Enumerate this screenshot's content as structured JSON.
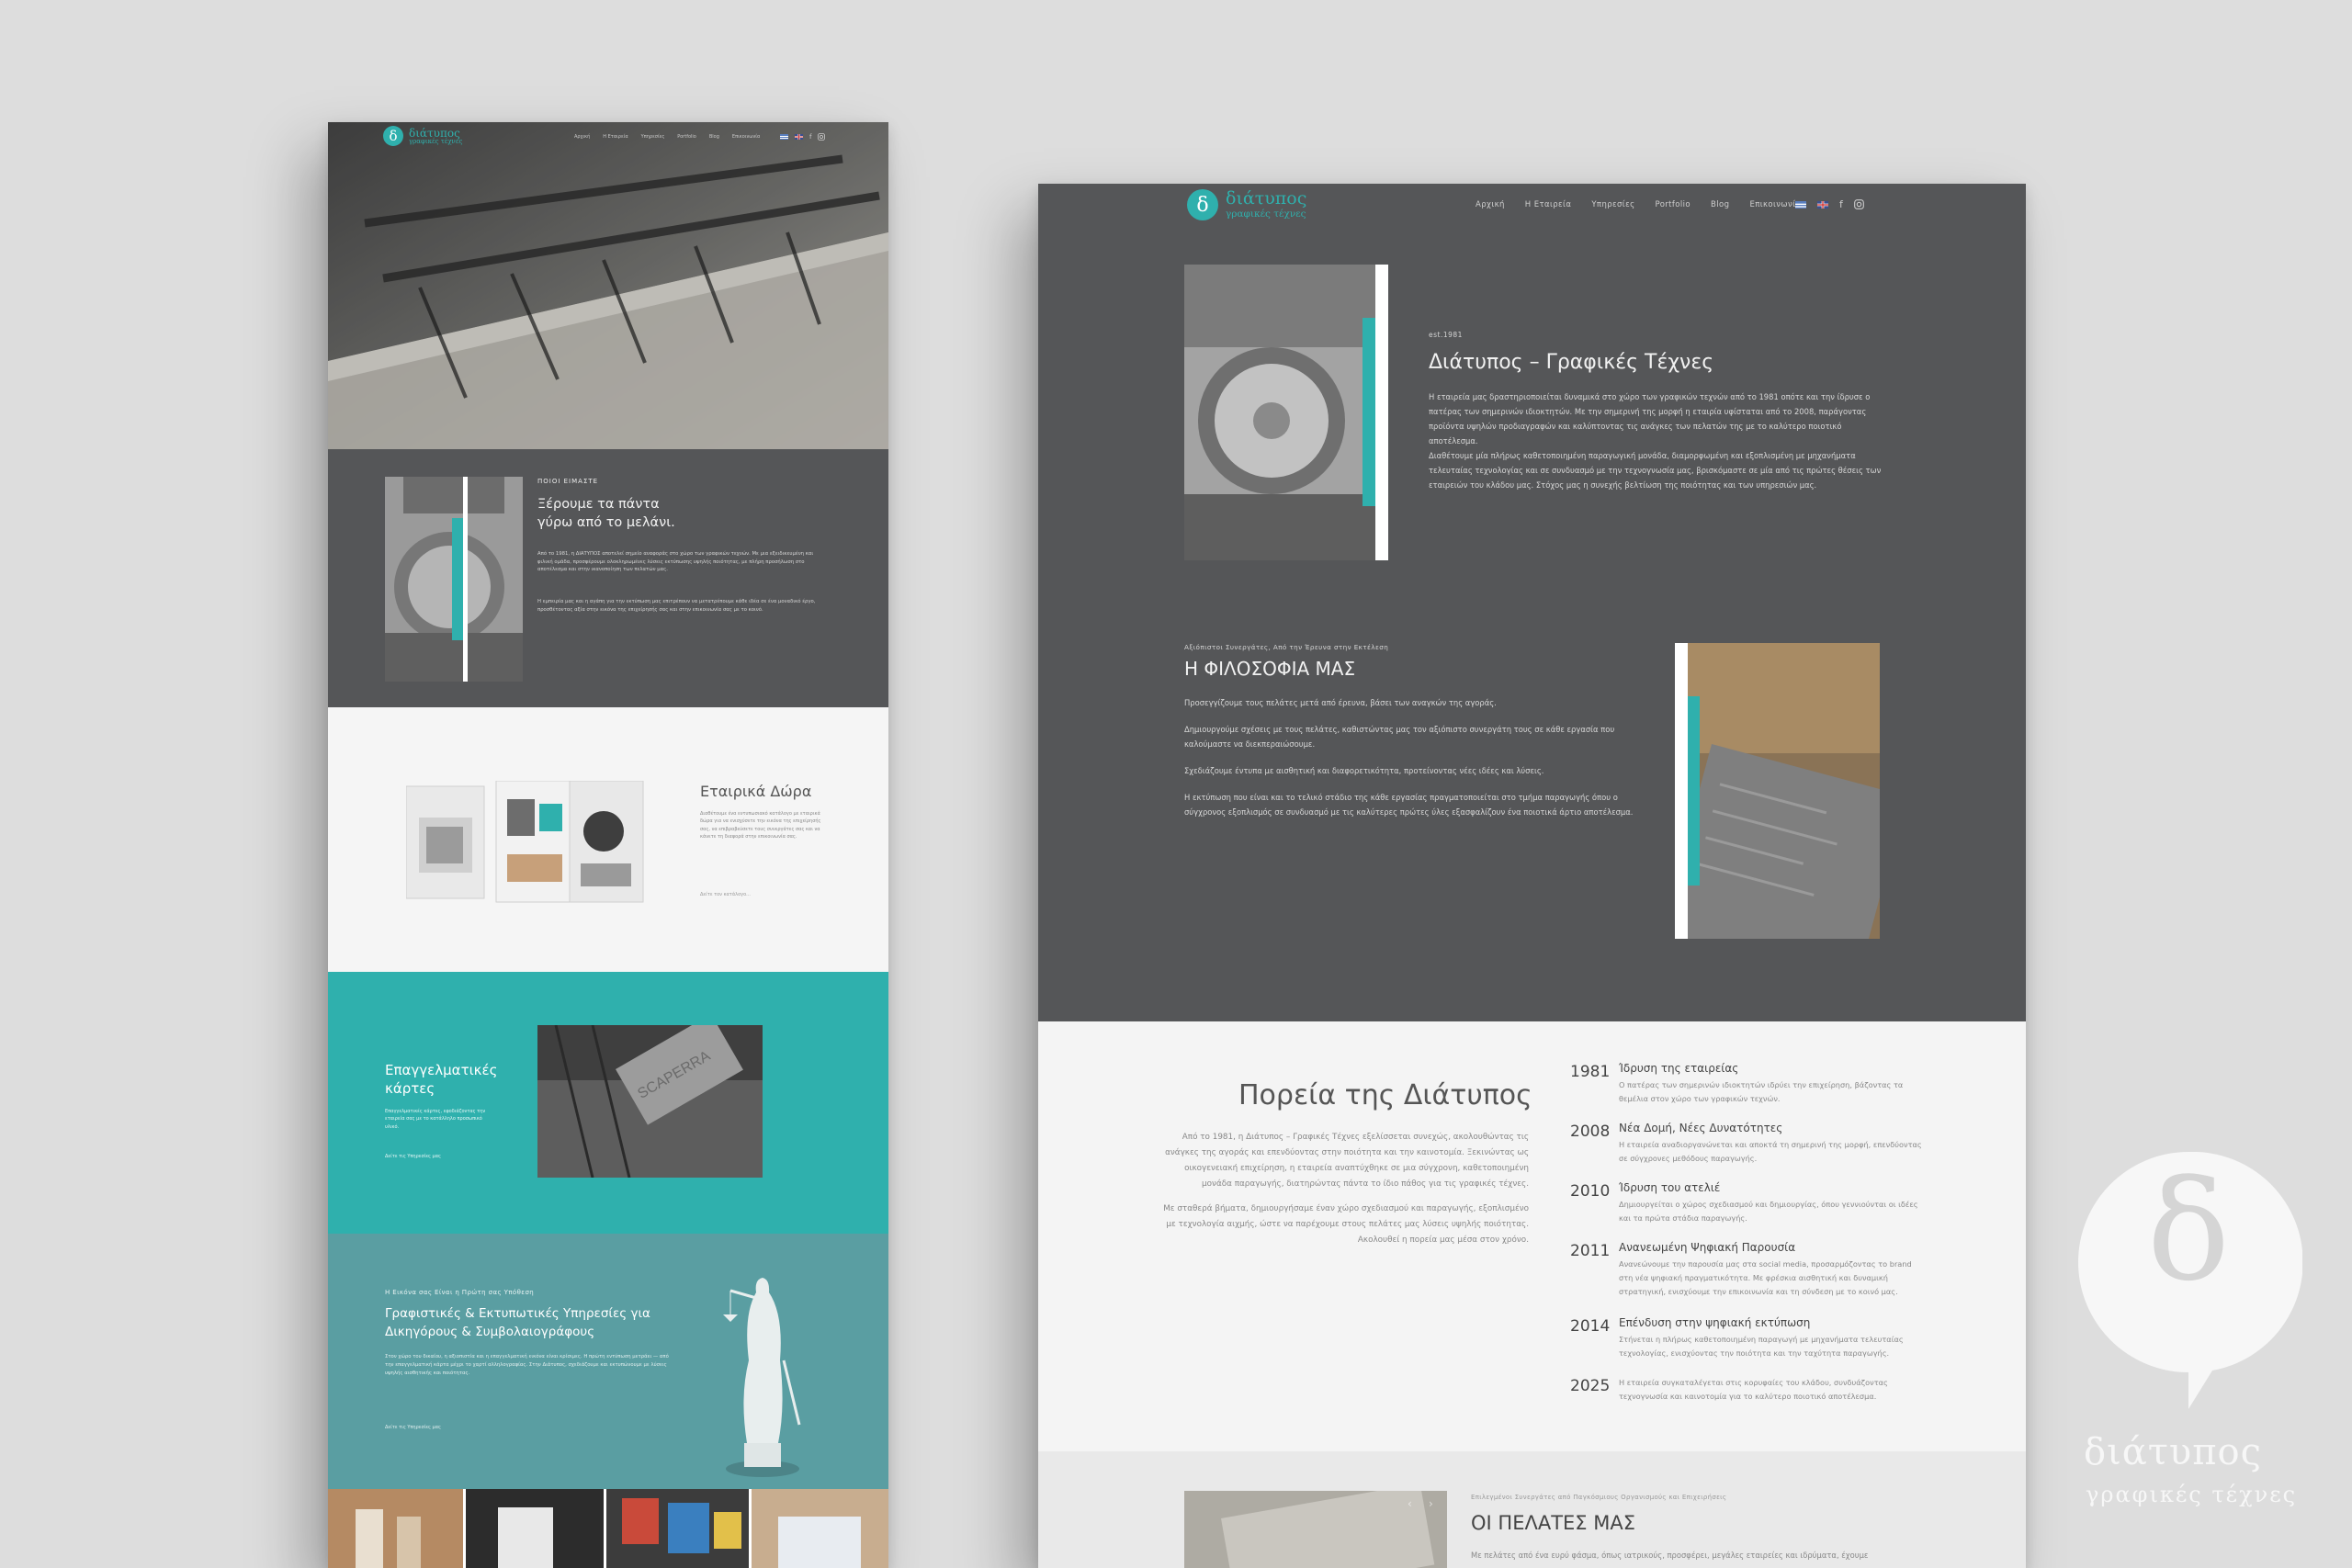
{
  "brand": {
    "logo_mark": "δ",
    "name": "διάτυπος",
    "tagline": "γραφικές τέχνες"
  },
  "nav": {
    "items": [
      "Αρχική",
      "Η Εταιρεία",
      "Υπηρεσίες",
      "Portfolio",
      "Blog",
      "Επικοινωνία"
    ]
  },
  "icons": [
    "facebook-icon",
    "instagram-icon",
    "flag-gr-icon",
    "flag-en-icon"
  ],
  "colors": {
    "accent": "#2fb0ad",
    "dark": "#555658",
    "legal": "#5a9ea2",
    "light": "#f4f4f4"
  },
  "left": {
    "about": {
      "eyebrow": "ΠΟΙΟΙ ΕΙΜΑΣΤΕ",
      "title_line1": "Ξέρουμε τα πάντα",
      "title_line2": "γύρω από το μελάνι.",
      "p1": "Από το 1981, η ΔΙΑΤΥΠΟΣ αποτελεί σημείο αναφοράς στο χώρο των γραφικών τεχνών. Με μια εξειδικευμένη και φιλική ομάδα, προσφέρουμε ολοκληρωμένες λύσεις εκτύπωσης υψηλής ποιότητας, με πλήρη προσήλωση στο αποτέλεσμα και στην ικανοποίηση των πελατών μας.",
      "p2": "Η εμπειρία μας και η αγάπη για την εκτύπωση μας επιτρέπουν να μετατρέπουμε κάθε ιδέα σε ένα μοναδικό έργο, προσθέτοντας αξία στην εικόνα της επιχείρησής σας και στην επικοινωνία σας με το κοινό."
    },
    "gifts": {
      "title": "Εταιρικά Δώρα",
      "body": "Διαθέτουμε ένα εντυπωσιακό κατάλογο με εταιρικά δώρα για να ενισχύσετε την εικόνα της επιχείρησής σας, να επιβραβεύσετε τους συνεργάτες σας και να κάνετε τη διαφορά στην επικοινωνία σας.",
      "link": "Δείτε τον κατάλογο..."
    },
    "cards": {
      "title_line1": "Επαγγελματικές",
      "title_line2": "κάρτες",
      "body": "Επαγγελματικές κάρτες, εφοδιάζοντας την εταιρεία σας με το κατάλληλο προσωπικό υλικό.",
      "link": "Δείτε τις Υπηρεσίες μας"
    },
    "legal": {
      "eyebrow": "Η Εικόνα σας Είναι η Πρώτη σας Υπόθεση",
      "title_line1": "Γραφιστικές & Εκτυπωτικές Υπηρεσίες για",
      "title_line2": "Δικηγόρους & Συμβολαιογράφους",
      "body": "Στον χώρο του δικαίου, η αξιοπιστία και η επαγγελματική εικόνα είναι κρίσιμες. Η πρώτη εντύπωση μετράει — από την επαγγελματική κάρτα μέχρι το χαρτί αλληλογραφίας. Στην Διάτυπος, σχεδιάζουμε και εκτυπώνουμε με λύσεις υψηλής αισθητικής και ποιότητας.",
      "link": "Δείτε τις Υπηρεσίες μας"
    }
  },
  "right": {
    "intro": {
      "eyebrow": "est.1981",
      "title": "Διάτυπος – Γραφικές Τέχνες",
      "p1": "Η εταιρεία μας δραστηριοποιείται δυναμικά στο χώρο των γραφικών τεχνών από το 1981 οπότε και την ίδρυσε ο πατέρας των σημερινών ιδιοκτητών. Με την σημερινή της μορφή η εταιρία υφίσταται από το 2008, παράγοντας προϊόντα υψηλών προδιαγραφών και καλύπτοντας τις ανάγκες των πελατών της με το καλύτερο ποιοτικό αποτέλεσμα.",
      "p2": "Διαθέτουμε μία πλήρως καθετοποιημένη παραγωγική μονάδα, διαμορφωμένη και εξοπλισμένη με μηχανήματα τελευταίας τεχνολογίας και σε συνδυασμό με την τεχνογνωσία μας, βρισκόμαστε σε μία από τις πρώτες θέσεις των εταιρειών του κλάδου μας. Στόχος μας η συνεχής βελτίωση της ποιότητας και των υπηρεσιών μας."
    },
    "philosophy": {
      "eyebrow": "Αξιόπιστοι Συνεργάτες, Από την Έρευνα στην Εκτέλεση",
      "title": "Η ΦΙΛΟΣΟΦΙΑ ΜΑΣ",
      "lines": [
        "Προσεγγίζουμε τους πελάτες μετά από έρευνα, βάσει των αναγκών της αγοράς.",
        "Δημιουργούμε σχέσεις με τους πελάτες, καθιστώντας μας τον αξιόπιστο συνεργάτη τους σε κάθε εργασία που καλούμαστε να διεκπεραιώσουμε.",
        "Σχεδιάζουμε έντυπα με αισθητική και διαφορετικότητα, προτείνοντας νέες ιδέες και λύσεις.",
        "Η εκτύπωση που είναι και το τελικό στάδιο της κάθε εργασίας πραγματοποιείται στο τμήμα παραγωγής όπου ο σύγχρονος εξοπλισμός σε συνδυασμό με τις καλύτερες πρώτες ύλες εξασφαλίζουν ένα ποιοτικά άρτιο αποτέλεσμα."
      ]
    },
    "history": {
      "title": "Πορεία της Διάτυπος",
      "p1": "Από το 1981, η Διάτυπος – Γραφικές Τέχνες εξελίσσεται συνεχώς, ακολουθώντας τις ανάγκες της αγοράς και επενδύοντας στην ποιότητα και την καινοτομία. Ξεκινώντας ως οικογενειακή επιχείρηση, η εταιρεία αναπτύχθηκε σε μια σύγχρονη, καθετοποιημένη μονάδα παραγωγής, διατηρώντας πάντα το ίδιο πάθος για τις γραφικές τέχνες.",
      "p2": "Με σταθερά βήματα, δημιουργήσαμε έναν χώρο σχεδιασμού και παραγωγής, εξοπλισμένο με τεχνολογία αιχμής, ώστε να παρέχουμε στους πελάτες μας λύσεις υψηλής ποιότητας. Ακολουθεί η πορεία μας μέσα στον χρόνο.",
      "timeline": [
        {
          "year": "1981",
          "title": "Ίδρυση της εταιρείας",
          "desc": "Ο πατέρας των σημερινών ιδιοκτητών ιδρύει την επιχείρηση, βάζοντας τα θεμέλια στον χώρο των γραφικών τεχνών."
        },
        {
          "year": "2008",
          "title": "Νέα Δομή, Νέες Δυνατότητες",
          "desc": "Η εταιρεία αναδιοργανώνεται και αποκτά τη σημερινή της μορφή, επενδύοντας σε σύγχρονες μεθόδους παραγωγής."
        },
        {
          "year": "2010",
          "title": "Ίδρυση του ατελιέ",
          "desc": "Δημιουργείται ο χώρος σχεδιασμού και δημιουργίας, όπου γεννιούνται οι ιδέες και τα πρώτα στάδια παραγωγής."
        },
        {
          "year": "2011",
          "title": "Ανανεωμένη Ψηφιακή Παρουσία",
          "desc": "Ανανεώνουμε την παρουσία μας στα social media, προσαρμόζοντας το brand στη νέα ψηφιακή πραγματικότητα. Με φρέσκια αισθητική και δυναμική στρατηγική, ενισχύουμε την επικοινωνία και τη σύνδεση με το κοινό μας."
        },
        {
          "year": "2014",
          "title": "Επένδυση στην ψηφιακή εκτύπωση",
          "desc": "Στήνεται η πλήρως καθετοποιημένη παραγωγή με μηχανήματα τελευταίας τεχνολογίας, ενισχύοντας την ποιότητα και την ταχύτητα παραγωγής."
        },
        {
          "year": "2025",
          "title": "",
          "desc": "Η εταιρεία συγκαταλέγεται στις κορυφαίες του κλάδου, συνδυάζοντας τεχνογνωσία και καινοτομία για το καλύτερο ποιοτικό αποτέλεσμα."
        }
      ]
    },
    "clients": {
      "eyebrow": "Επιλεγμένοι Συνεργάτες από Παγκόσμιους Οργανισμούς και Επιχειρήσεις",
      "title": "ΟΙ ΠΕΛΑΤΕΣ ΜΑΣ",
      "body": "Με πελάτες από ένα ευρύ φάσμα, όπως ιατρικούς, προσφέρει, μεγάλες εταιρείες και ιδρύματα, έχουμε"
    }
  },
  "watermark": {
    "mark": "δ",
    "name": "διάτυπος",
    "tagline": "γραφικές τέχνες"
  }
}
